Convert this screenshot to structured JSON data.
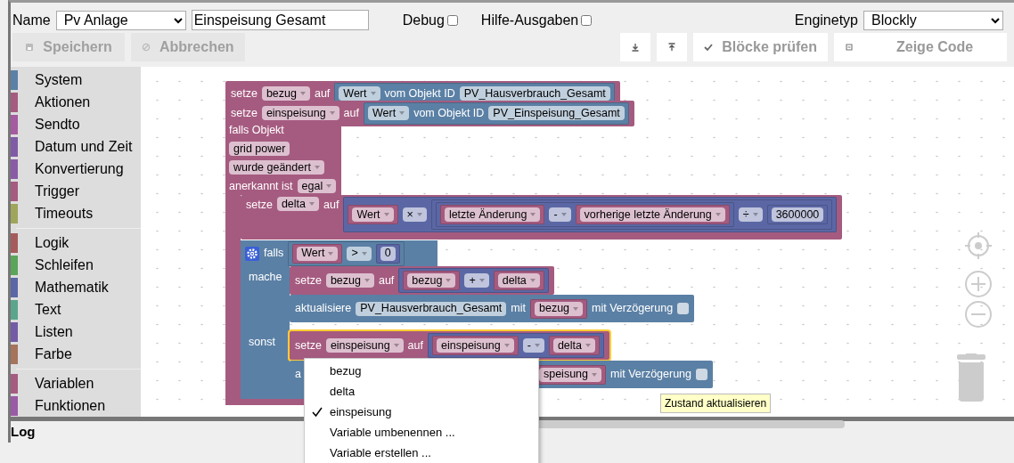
{
  "header": {
    "name_label": "Name",
    "folder": "Pv Anlage",
    "script_name": "Einspeisung Gesamt",
    "options": [
      {
        "label": "Debug",
        "checked": false
      },
      {
        "label": "Hilfe-Ausgaben",
        "checked": false
      }
    ],
    "engine_label": "Enginetyp",
    "engine": "Blockly"
  },
  "toolbar": {
    "left": [
      {
        "kind": "save",
        "label": "Speichern",
        "disabled": true
      },
      {
        "kind": "cancel",
        "label": "Abbrechen",
        "disabled": true
      }
    ],
    "right": [
      {
        "kind": "export",
        "disabled": false
      },
      {
        "kind": "import",
        "disabled": false
      },
      {
        "kind": "check",
        "label": "Blöcke prüfen",
        "disabled": false
      },
      {
        "kind": "code",
        "label": "Zeige Code",
        "disabled": false
      }
    ]
  },
  "toolbox": [
    {
      "items": [
        {
          "label": "System",
          "color": "#5b80a5"
        },
        {
          "label": "Aktionen",
          "color": "#a55b80"
        },
        {
          "label": "Sendto",
          "color": "#a55ba0"
        },
        {
          "label": "Datum und Zeit",
          "color": "#805ba5"
        },
        {
          "label": "Konvertierung",
          "color": "#8a5ba5"
        },
        {
          "label": "Trigger",
          "color": "#a55b80"
        },
        {
          "label": "Timeouts",
          "color": "#9fa55b"
        }
      ]
    },
    {
      "items": [
        {
          "label": "Logik",
          "color": "#a55b5b"
        },
        {
          "label": "Schleifen",
          "color": "#5ba55b"
        },
        {
          "label": "Mathematik",
          "color": "#5b67a5"
        },
        {
          "label": "Text",
          "color": "#5ba58c"
        },
        {
          "label": "Listen",
          "color": "#745ba5"
        },
        {
          "label": "Farbe",
          "color": "#a5745b"
        }
      ]
    },
    {
      "items": [
        {
          "label": "Variablen",
          "color": "#a55b80"
        },
        {
          "label": "Funktionen",
          "color": "#995ba5"
        }
      ]
    }
  ],
  "blocks": [
    {
      "kind": "statement",
      "color": "#a55b80",
      "selected": false,
      "items": [
        {
          "kind": "label",
          "text": "setze"
        },
        {
          "kind": "dropdown",
          "text": "bezug"
        },
        {
          "kind": "label",
          "text": "auf"
        },
        {
          "kind": "block",
          "color": "#5b80a5",
          "items": [
            {
              "kind": "dropdown",
              "text": "Wert"
            },
            {
              "kind": "label",
              "text": "vom Objekt ID"
            },
            {
              "kind": "field",
              "text": "PV_Hausverbrauch_Gesamt"
            }
          ]
        }
      ]
    },
    {
      "kind": "statement",
      "color": "#a55b80",
      "selected": false,
      "items": [
        {
          "kind": "label",
          "text": "setze"
        },
        {
          "kind": "dropdown",
          "text": "einspeisung"
        },
        {
          "kind": "label",
          "text": "auf"
        },
        {
          "kind": "block",
          "color": "#5b80a5",
          "items": [
            {
              "kind": "dropdown",
              "text": "Wert"
            },
            {
              "kind": "label",
              "text": "vom Objekt ID"
            },
            {
              "kind": "field",
              "text": "PV_Einspeisung_Gesamt"
            }
          ]
        }
      ]
    },
    {
      "kind": "trigger",
      "color": "#a55b80",
      "selected": false,
      "rows": [
        {
          "items": [
            {
              "kind": "label",
              "text": "falls Objekt"
            }
          ]
        },
        {
          "items": [
            {
              "kind": "field",
              "text": "grid power"
            }
          ]
        },
        {
          "items": [
            {
              "kind": "dropdown",
              "text": "wurde geändert"
            }
          ]
        },
        {
          "items": [
            {
              "kind": "label",
              "text": "anerkannt ist"
            },
            {
              "kind": "dropdown",
              "text": "egal"
            }
          ]
        }
      ]
    },
    {
      "kind": "statement",
      "color": "#a55b80",
      "selected": false,
      "items": [
        {
          "kind": "label",
          "text": "setze"
        },
        {
          "kind": "dropdown",
          "text": "delta"
        },
        {
          "kind": "label",
          "text": "auf"
        },
        {
          "kind": "block",
          "color": "#5b67a5",
          "items": [
            {
              "kind": "block",
              "color": "#a55b80",
              "items": [
                {
                  "kind": "dropdown",
                  "text": "Wert"
                }
              ]
            },
            {
              "kind": "dropdown",
              "text": "×"
            },
            {
              "kind": "block",
              "color": "#5b67a5",
              "items": [
                {
                  "kind": "block",
                  "color": "#5b67a5",
                  "items": [
                    {
                      "kind": "block",
                      "color": "#a55b80",
                      "items": [
                        {
                          "kind": "dropdown",
                          "text": "letzte Änderung"
                        }
                      ]
                    },
                    {
                      "kind": "dropdown",
                      "text": "-"
                    },
                    {
                      "kind": "block",
                      "color": "#a55b80",
                      "items": [
                        {
                          "kind": "dropdown",
                          "text": "vorherige letzte Änderung"
                        }
                      ]
                    }
                  ]
                },
                {
                  "kind": "dropdown",
                  "text": "÷"
                },
                {
                  "kind": "block",
                  "color": "#5b67a5",
                  "items": [
                    {
                      "kind": "field",
                      "text": "3600000"
                    }
                  ]
                }
              ]
            }
          ]
        }
      ]
    },
    {
      "kind": "if",
      "color": "#5b80a5",
      "selected": false,
      "items": [
        {
          "kind": "gear"
        },
        {
          "kind": "label",
          "text": "falls"
        },
        {
          "kind": "block",
          "color": "#5b80a5",
          "items": [
            {
              "kind": "block",
              "color": "#a55b80",
              "items": [
                {
                  "kind": "dropdown",
                  "text": "Wert"
                }
              ]
            },
            {
              "kind": "dropdown",
              "text": ">"
            },
            {
              "kind": "block",
              "color": "#5b67a5",
              "items": [
                {
                  "kind": "field",
                  "text": "0"
                }
              ]
            }
          ]
        }
      ],
      "branch_labels": [
        "mache",
        "sonst"
      ]
    },
    {
      "kind": "statement",
      "color": "#a55b80",
      "selected": false,
      "items": [
        {
          "kind": "label",
          "text": "setze"
        },
        {
          "kind": "dropdown",
          "text": "bezug"
        },
        {
          "kind": "label",
          "text": "auf"
        },
        {
          "kind": "block",
          "color": "#5b67a5",
          "items": [
            {
              "kind": "block",
              "color": "#a55b80",
              "items": [
                {
                  "kind": "dropdown",
                  "text": "bezug"
                }
              ]
            },
            {
              "kind": "dropdown",
              "text": "+"
            },
            {
              "kind": "block",
              "color": "#a55b80",
              "items": [
                {
                  "kind": "dropdown",
                  "text": "delta"
                }
              ]
            }
          ]
        }
      ]
    },
    {
      "kind": "statement",
      "color": "#5b80a5",
      "selected": false,
      "items": [
        {
          "kind": "label",
          "text": "aktualisiere"
        },
        {
          "kind": "field",
          "text": "PV_Hausverbrauch_Gesamt"
        },
        {
          "kind": "label",
          "text": "mit"
        },
        {
          "kind": "block",
          "color": "#a55b80",
          "items": [
            {
              "kind": "dropdown",
              "text": "bezug"
            }
          ]
        },
        {
          "kind": "label",
          "text": "mit Verzögerung"
        },
        {
          "kind": "checkbox",
          "checked": false
        }
      ]
    },
    {
      "kind": "statement",
      "color": "#a55b80",
      "selected": true,
      "items": [
        {
          "kind": "label",
          "text": "setze"
        },
        {
          "kind": "dropdown",
          "text": "einspeisung"
        },
        {
          "kind": "label",
          "text": "auf"
        },
        {
          "kind": "block",
          "color": "#5b67a5",
          "items": [
            {
              "kind": "block",
              "color": "#a55b80",
              "items": [
                {
                  "kind": "dropdown",
                  "text": "einspeisung"
                }
              ]
            },
            {
              "kind": "dropdown",
              "text": "-"
            },
            {
              "kind": "block",
              "color": "#a55b80",
              "items": [
                {
                  "kind": "dropdown",
                  "text": "delta"
                }
              ]
            }
          ]
        }
      ]
    },
    {
      "kind": "statement",
      "color": "#5b80a5",
      "selected": false,
      "items": [
        {
          "kind": "label",
          "text": "a"
        },
        {
          "kind": "hidden"
        },
        {
          "kind": "block",
          "color": "#a55b80",
          "items": [
            {
              "kind": "dropdown",
              "text": "speisung"
            }
          ]
        },
        {
          "kind": "label",
          "text": "mit Verzögerung"
        },
        {
          "kind": "checkbox",
          "checked": false
        }
      ]
    }
  ],
  "context_menu": {
    "items": [
      {
        "label": "bezug",
        "checked": false
      },
      {
        "label": "delta",
        "checked": false
      },
      {
        "label": "einspeisung",
        "checked": true
      },
      {
        "label": "Variable umbenennen ...",
        "checked": false
      },
      {
        "label": "Variable erstellen ...",
        "checked": false
      }
    ]
  },
  "tooltip": "Zustand aktualisieren",
  "log": {
    "title": "Log"
  }
}
